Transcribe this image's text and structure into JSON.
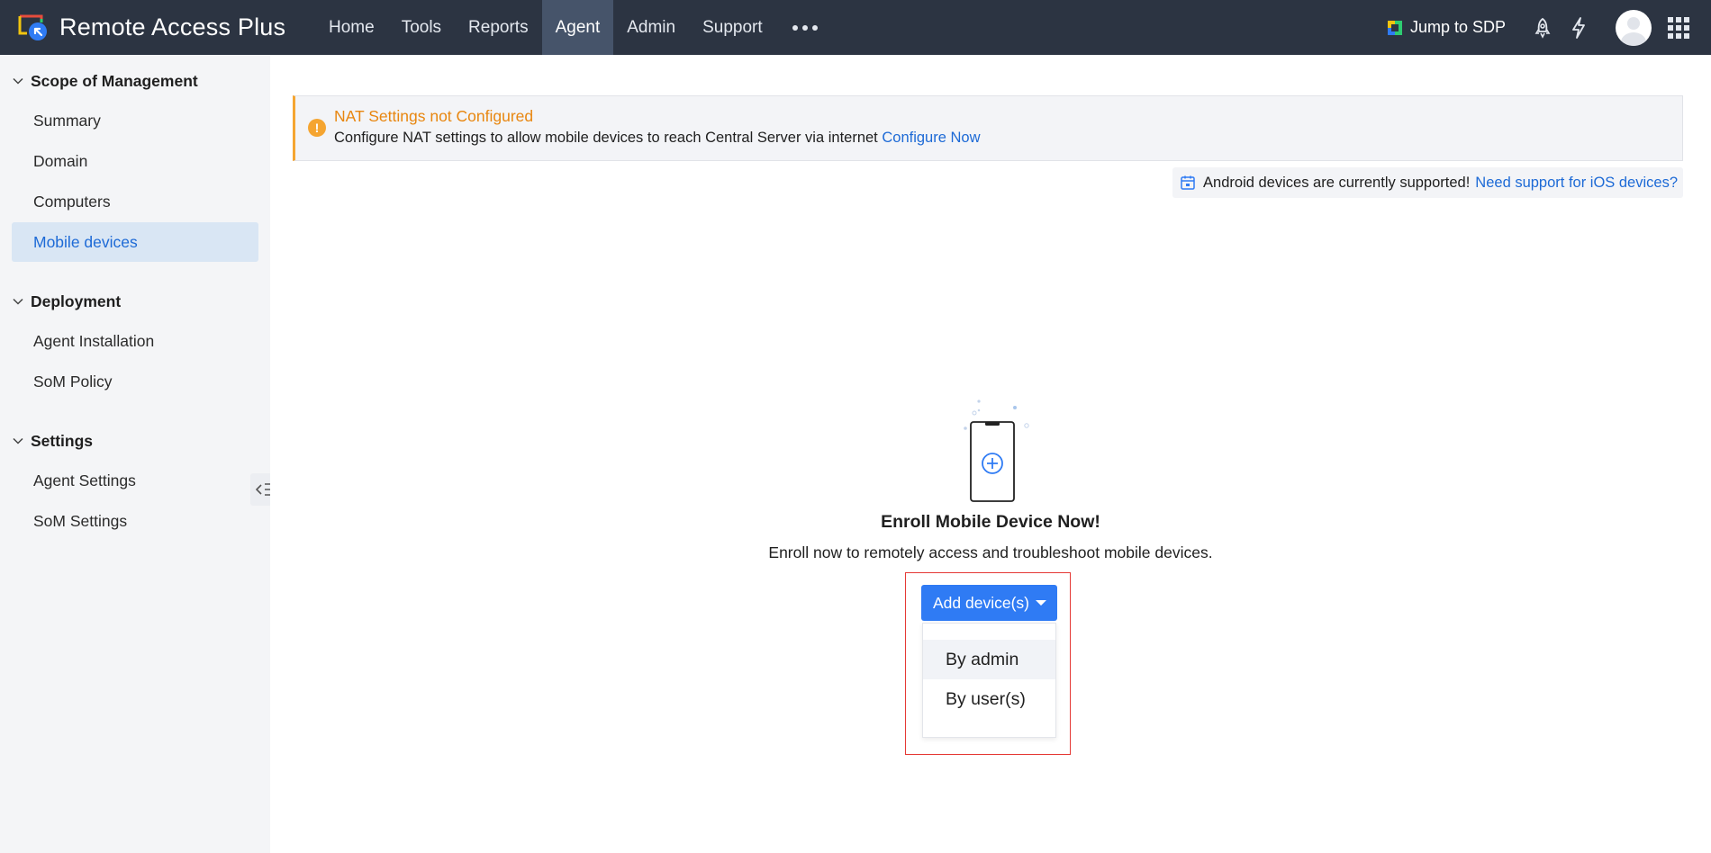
{
  "header": {
    "app_title": "Remote Access Plus",
    "nav": [
      {
        "label": "Home"
      },
      {
        "label": "Tools"
      },
      {
        "label": "Reports"
      },
      {
        "label": "Agent"
      },
      {
        "label": "Admin"
      },
      {
        "label": "Support"
      }
    ],
    "active_nav": "Agent",
    "jump_label": "Jump to SDP"
  },
  "sidebar": {
    "sections": [
      {
        "title": "Scope of Management",
        "items": [
          "Summary",
          "Domain",
          "Computers",
          "Mobile devices"
        ]
      },
      {
        "title": "Deployment",
        "items": [
          "Agent Installation",
          "SoM Policy"
        ]
      },
      {
        "title": "Settings",
        "items": [
          "Agent Settings",
          "SoM Settings"
        ]
      }
    ],
    "active_item": "Mobile devices"
  },
  "banner": {
    "title": "NAT Settings not Configured",
    "description": "Configure NAT settings to allow mobile devices to reach Central Server via internet",
    "link": "Configure Now"
  },
  "ios_note": {
    "text": "Android devices are currently supported!",
    "link": "Need support for iOS devices?"
  },
  "empty_state": {
    "title": "Enroll Mobile Device Now!",
    "description": "Enroll now to remotely access and troubleshoot mobile devices."
  },
  "add_device": {
    "button_label": "Add device(s)",
    "options": [
      "By admin",
      "By user(s)"
    ]
  },
  "colors": {
    "topbar": "#2c3442",
    "active_nav": "#46546a",
    "primary": "#2f7bf4",
    "link": "#1d6ad6",
    "warning": "#f5a531",
    "highlight": "#e53935"
  }
}
